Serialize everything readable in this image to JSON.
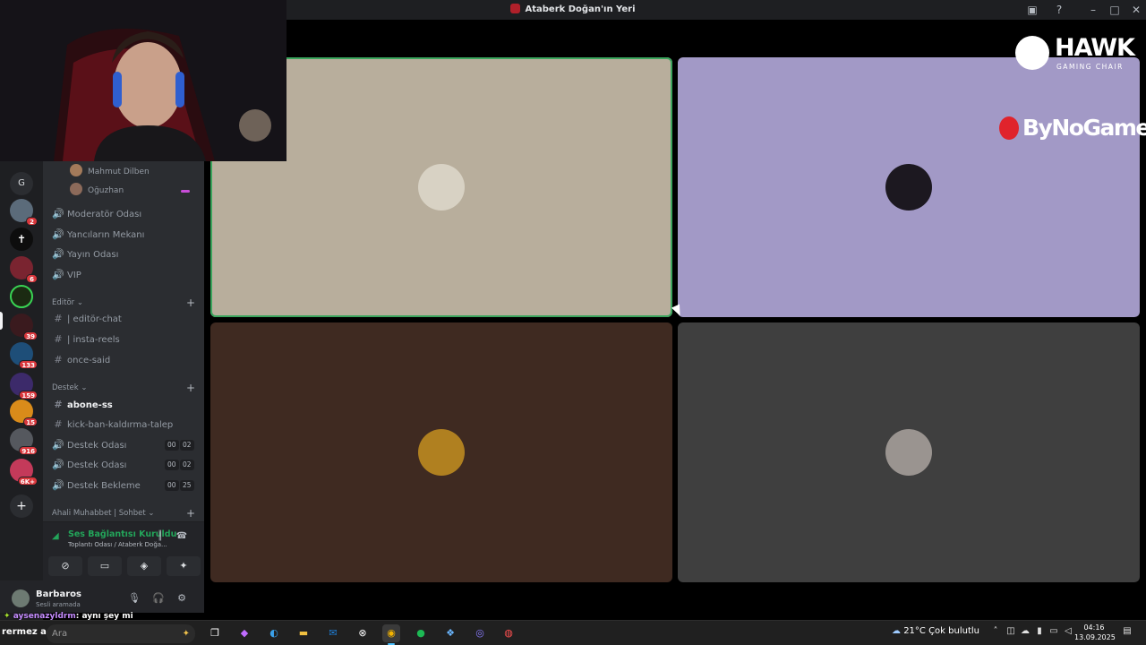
{
  "window": {
    "title": "Ataberk Doğan'ın Yeri"
  },
  "server_rail": {
    "badges": [
      "2",
      "6",
      "39",
      "133",
      "159",
      "15",
      "916",
      "6K+"
    ]
  },
  "sidebar": {
    "voice_users": [
      "Mahmut Dilben",
      "Oğuzhan"
    ],
    "voice_channels": [
      "Moderatör Odası",
      "Yancıların Mekanı",
      "Yayın Odası",
      "VIP"
    ],
    "categories": {
      "editor": "Editör",
      "destek": "Destek",
      "ahali": "Ahali Muhabbet | Sohbet"
    },
    "editor_channels": [
      "| editör-chat",
      "| insta-reels",
      "once-said"
    ],
    "destek_channels": {
      "abone": "abone-ss",
      "kick": "kick-ban-kaldırma-talep",
      "destek1": "Destek Odası",
      "destek1_m": "00",
      "destek1_s": "02",
      "destek2": "Destek Odası",
      "destek2_m": "00",
      "destek2_s": "02",
      "bekleme": "Destek Bekleme",
      "bekleme_m": "00",
      "bekleme_s": "25"
    }
  },
  "voice_panel": {
    "status": "Ses Bağlantısı Kuruldu",
    "location": "Toplantı Odası / Ataberk Doğa..."
  },
  "user_panel": {
    "name": "Barbaros",
    "status": "Sesli aramada"
  },
  "chat_overlay": {
    "user": "aysenazyldrm",
    "message": ": aynı şey mi",
    "partial": "rermez aq"
  },
  "stage": {
    "tile_colors": [
      "#b8ae9c",
      "#a299c6",
      "#3f2a21",
      "#3f3f3f"
    ]
  },
  "sponsors": {
    "hawk": "HAWK",
    "hawk_sub": "GAMING CHAIR",
    "bynogame": "ByNoGame"
  },
  "taskbar": {
    "search_placeholder": "Ara",
    "weather": "21°C  Çok bulutlu",
    "time": "04:16",
    "date": "13.09.2025"
  }
}
